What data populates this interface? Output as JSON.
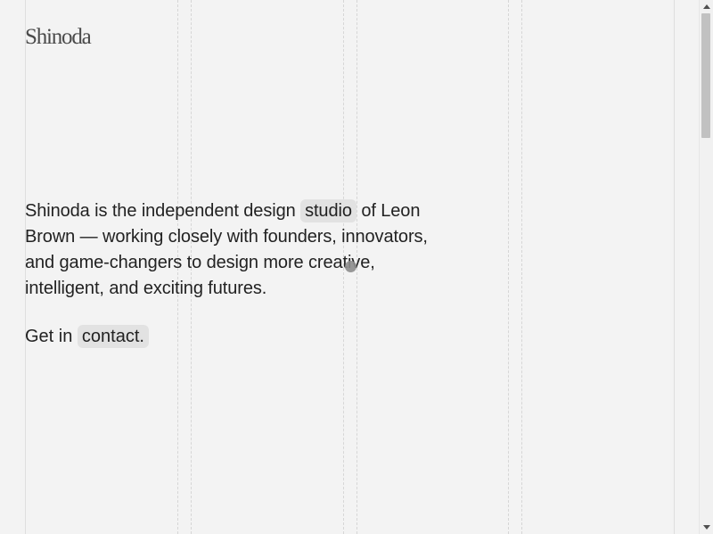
{
  "header": {
    "logo_text": "Shinoda"
  },
  "intro": {
    "text_before": "Shinoda is the independent design ",
    "link_studio": "studio",
    "text_after": " of Leon Brown — working closely with founders, innovators, and game-changers to design more creative, intelligent, and exciting futures."
  },
  "contact": {
    "prefix": "Get in ",
    "link_label": "contact."
  },
  "colors": {
    "background": "#f3f3f3",
    "text": "#222222",
    "pill": "#e2e2e2",
    "grid_line": "#d6d6d6"
  }
}
